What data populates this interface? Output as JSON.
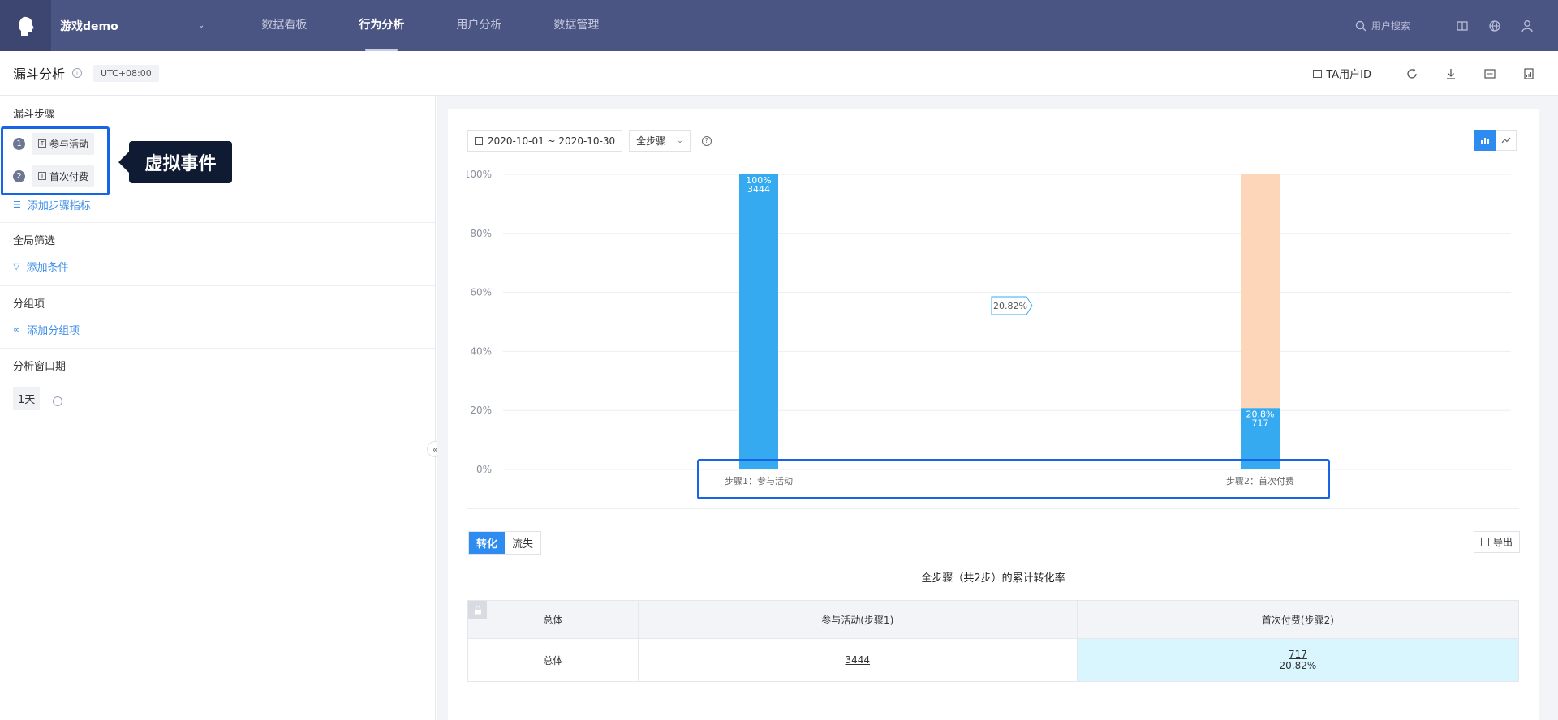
{
  "app": {
    "name": "游戏demo"
  },
  "nav": {
    "tabs": [
      "数据看板",
      "行为分析",
      "用户分析",
      "数据管理"
    ],
    "active_index": 1
  },
  "search": {
    "placeholder": "用户搜索"
  },
  "page": {
    "title": "漏斗分析",
    "timezone": "UTC+08:00",
    "ta_user_id": "TA用户ID"
  },
  "left": {
    "funnel_steps_title": "漏斗步骤",
    "steps": [
      {
        "num": "1",
        "label": "参与活动"
      },
      {
        "num": "2",
        "label": "首次付费"
      }
    ],
    "add_step_metric": "添加步骤指标",
    "global_filter_title": "全局筛选",
    "add_condition": "添加条件",
    "group_title": "分组项",
    "add_group": "添加分组项",
    "window_title": "分析窗口期",
    "window_value": "1天",
    "callout": "虚拟事件"
  },
  "toolbar": {
    "date_range": "2020-10-01 ~ 2020-10-30",
    "step_select": "全步骤"
  },
  "chart_data": {
    "type": "bar",
    "categories": [
      "步骤1：参与活动",
      "步骤2：首次付费"
    ],
    "values_percent": [
      100,
      20.8
    ],
    "counts": [
      3444,
      717
    ],
    "bar_labels": [
      [
        "100%",
        "3444"
      ],
      [
        "20.8%",
        "717"
      ]
    ],
    "conversion_label": "20.82%",
    "y_ticks": [
      "0%",
      "20%",
      "40%",
      "60%",
      "80%",
      "100%"
    ],
    "ylim": [
      0,
      100
    ],
    "colors": {
      "bar": "#35aaf0",
      "remainder": "#fdd5b8",
      "grid": "#eceef2"
    }
  },
  "bottom": {
    "tabs": [
      "转化",
      "流失"
    ],
    "export": "导出",
    "caption": "全步骤（共2步）的累计转化率",
    "headers": [
      "总体",
      "参与活动(步骤1)",
      "首次付费(步骤2)"
    ],
    "row": {
      "label": "总体",
      "step1": "3444",
      "step2": "717",
      "step2_rate": "20.82%"
    }
  }
}
